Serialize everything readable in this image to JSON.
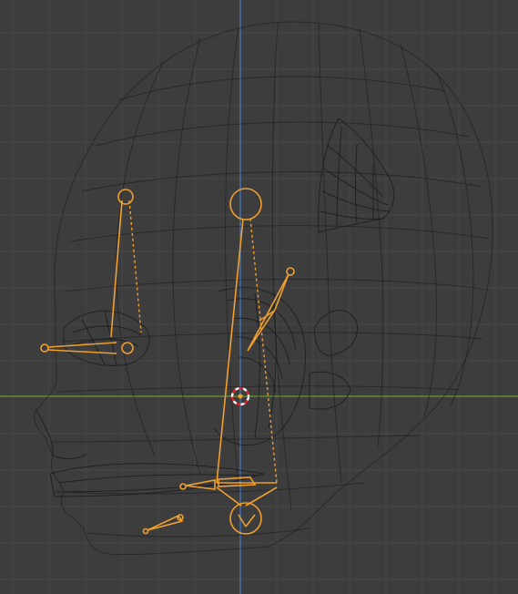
{
  "viewport": {
    "mode": "wireframe",
    "object": "head",
    "selection": "armature",
    "colors": {
      "background": "#3d3d3d",
      "grid": "#474747",
      "x_axis": "#6c9a2e",
      "z_axis": "#3f7fd0",
      "wire": "#1a1a1a",
      "bone_selected": "#f0a030",
      "cursor_red": "#d9252c"
    }
  }
}
